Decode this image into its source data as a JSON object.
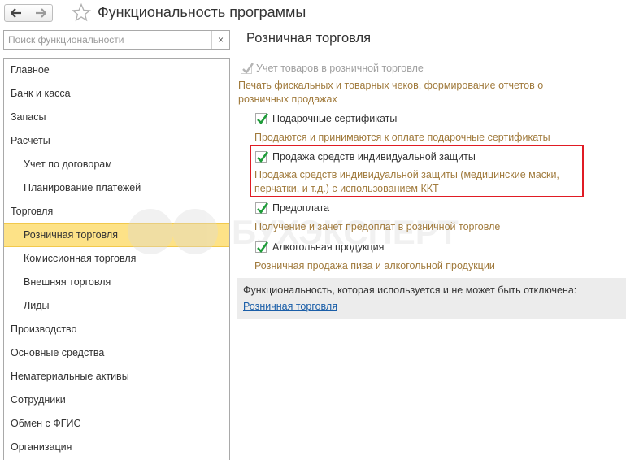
{
  "header": {
    "title": "Функциональность программы",
    "back_icon": "arrow-left-icon",
    "forward_icon": "arrow-right-icon",
    "favorite_icon": "star-icon"
  },
  "search": {
    "placeholder": "Поиск функциональности",
    "value": "",
    "clear_label": "×"
  },
  "sidebar": {
    "items": [
      {
        "label": "Главное",
        "level": 0,
        "selected": false
      },
      {
        "label": "Банк и касса",
        "level": 0,
        "selected": false
      },
      {
        "label": "Запасы",
        "level": 0,
        "selected": false
      },
      {
        "label": "Расчеты",
        "level": 0,
        "selected": false
      },
      {
        "label": "Учет по договорам",
        "level": 1,
        "selected": false
      },
      {
        "label": "Планирование платежей",
        "level": 1,
        "selected": false
      },
      {
        "label": "Торговля",
        "level": 0,
        "selected": false
      },
      {
        "label": "Розничная торговля",
        "level": 1,
        "selected": true
      },
      {
        "label": "Комиссионная торговля",
        "level": 1,
        "selected": false
      },
      {
        "label": "Внешняя торговля",
        "level": 1,
        "selected": false
      },
      {
        "label": "Лиды",
        "level": 1,
        "selected": false
      },
      {
        "label": "Производство",
        "level": 0,
        "selected": false
      },
      {
        "label": "Основные средства",
        "level": 0,
        "selected": false
      },
      {
        "label": "Нематериальные активы",
        "level": 0,
        "selected": false
      },
      {
        "label": "Сотрудники",
        "level": 0,
        "selected": false
      },
      {
        "label": "Обмен с ФГИС",
        "level": 0,
        "selected": false
      },
      {
        "label": "Организация",
        "level": 0,
        "selected": false
      }
    ]
  },
  "main": {
    "section_title": "Розничная торговля",
    "options": {
      "retail": {
        "label": "Учет товаров в розничной торговле",
        "checked": true,
        "disabled": true,
        "description": "Печать фискальных и товарных чеков, формирование отчетов о розничных продажах",
        "description_line1": "Печать фискальных и товарных чеков, формирование отчетов о",
        "description_line2": "розничных продажах"
      },
      "gift_cards": {
        "label": "Подарочные сертификаты",
        "checked": true,
        "description": "Продаются и принимаются к оплате подарочные сертификаты"
      },
      "ppe": {
        "label": "Продажа средств индивидуальной защиты",
        "checked": true,
        "highlighted": true,
        "description_line1": "Продажа средств индивидуальной защиты (медицинские маски,",
        "description_line2": "перчатки, и т.д.) с использованием ККТ"
      },
      "prepayment": {
        "label": "Предоплата",
        "checked": true,
        "description": "Получение и зачет предоплат в розничной торговле"
      },
      "alcohol": {
        "label": "Алкогольная продукция",
        "checked": true,
        "description": "Розничная продажа пива и алкогольной продукции"
      }
    },
    "locked_panel": {
      "text": "Функциональность, которая используется и не может быть отключена:",
      "link": "Розничная торговля"
    }
  },
  "watermark": {
    "text": "БУХЭКСПЕРТ"
  },
  "colors": {
    "selected_bg": "#fde287",
    "check_green": "#1f9c3a",
    "description_text": "#a07a3c",
    "highlight_border": "#e01b24",
    "link": "#1a5ea8",
    "panel_bg": "#ececec"
  }
}
